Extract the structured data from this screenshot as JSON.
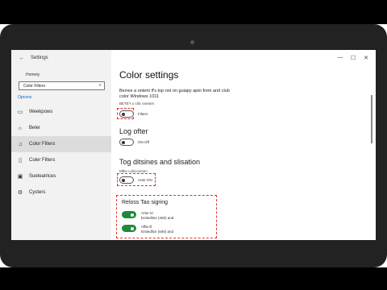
{
  "window": {
    "app_title": "Settings",
    "controls": [
      "—",
      "☐",
      "✕"
    ]
  },
  "sidebar": {
    "home": "Homety",
    "search_value": "Color Filters",
    "section_label": "Opcons",
    "items": [
      {
        "label": "Weekpows",
        "icon": "display-icon"
      },
      {
        "label": "Beler",
        "icon": "brightness-icon"
      },
      {
        "label": "Color Filters",
        "icon": "music-icon",
        "active": true
      },
      {
        "label": "Coler Filters",
        "icon": "tablet-icon"
      },
      {
        "label": "Sueteatrices",
        "icon": "window-icon"
      },
      {
        "label": "Cysters",
        "icon": "gear-icon"
      }
    ]
  },
  "main": {
    "title": "Color settings",
    "description": "Berree a ontent if's top not on guiapy apto frem and club color Windows 1011",
    "setting1": {
      "small": "BETEY o cilic sxream",
      "toggle_label": "Filters",
      "on": false
    },
    "setting2": {
      "title": "Log ofter",
      "toggle_label": "ON Off",
      "on": false
    },
    "setting3": {
      "title": "Tog ditsines and slisation",
      "small": "Mftm colicicemen",
      "toggle_label": "Arter ON",
      "on": false
    },
    "group": {
      "title": "Reloss Tao sigring",
      "rows": [
        {
          "line1": "Arter III",
          "line2": "Entiedline (400) and",
          "on": true
        },
        {
          "line1": "Affte ill",
          "line2": "Entiedllce (500) and",
          "on": true
        }
      ]
    }
  }
}
